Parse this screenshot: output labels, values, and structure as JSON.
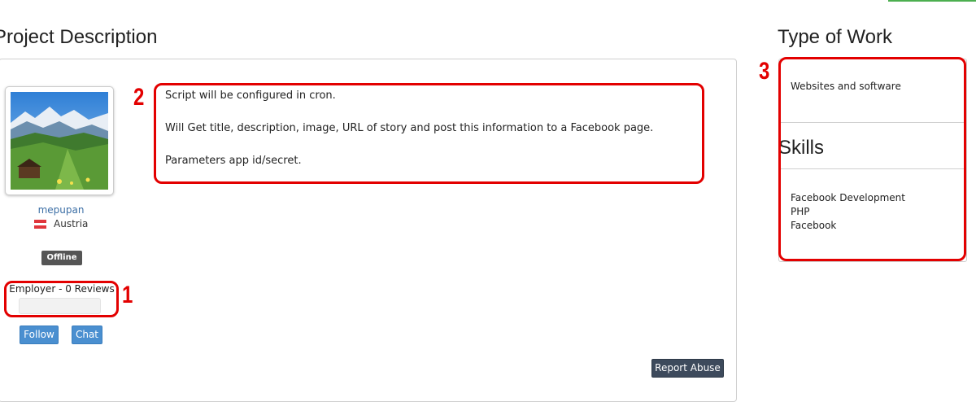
{
  "project": {
    "section_title": "Project Description",
    "description": [
      "Script will be configured in cron.",
      "Will Get title, description, image, URL of story and post this information to a Facebook page.",
      "Parameters app id/secret."
    ],
    "report_label": "Report Abuse"
  },
  "employer": {
    "username": "mepupan",
    "country": "Austria",
    "status": "Offline",
    "reviews_label": "Employer - 0 Reviews",
    "rating_fraction": 0,
    "follow_label": "Follow",
    "chat_label": "Chat",
    "flag_colors": [
      "#e0363c",
      "#ffffff",
      "#e0363c"
    ]
  },
  "sidebar": {
    "type_title": "Type of Work",
    "type_value": "Websites and software",
    "skills_title": "Skills",
    "skills": [
      "Facebook Development",
      "PHP",
      "Facebook"
    ]
  },
  "annotations": {
    "markers": [
      "1",
      "2",
      "3"
    ],
    "highlight_color": "#e30000"
  }
}
